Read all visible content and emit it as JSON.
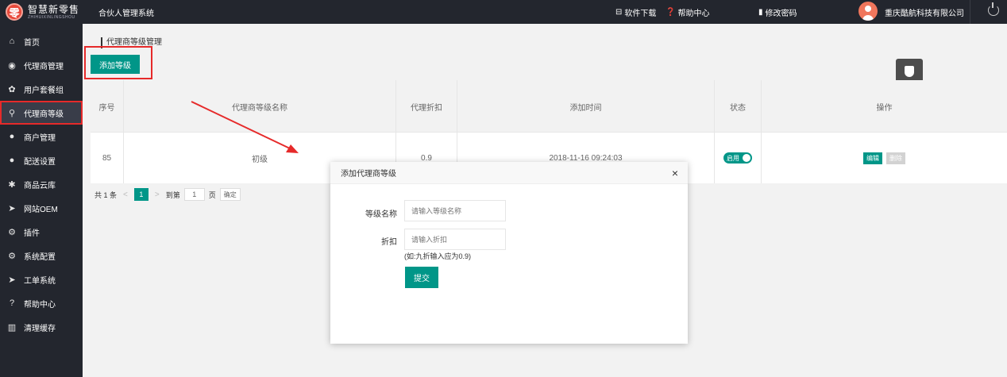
{
  "topbar": {
    "logo_cn": "智慧新零售",
    "logo_en": "ZHIHUIXINLINGSHOU",
    "logo_mark": "零",
    "system_title": "合伙人管理系统",
    "software_download": "软件下载",
    "help_center": "帮助中心",
    "change_password": "修改密码",
    "company": "重庆酷航科技有限公司"
  },
  "sidebar": {
    "items": [
      {
        "label": "首页",
        "icon": "home-icon",
        "glyph": "⌂"
      },
      {
        "label": "代理商管理",
        "icon": "agent-icon",
        "glyph": "◉"
      },
      {
        "label": "用户套餐组",
        "icon": "package-icon",
        "glyph": "✿"
      },
      {
        "label": "代理商等级",
        "icon": "level-icon",
        "glyph": "⚲"
      },
      {
        "label": "商户管理",
        "icon": "merchant-icon",
        "glyph": "●"
      },
      {
        "label": "配送设置",
        "icon": "delivery-icon",
        "glyph": "●"
      },
      {
        "label": "商品云库",
        "icon": "cloud-icon",
        "glyph": "✱"
      },
      {
        "label": "网站OEM",
        "icon": "website-icon",
        "glyph": "➤"
      },
      {
        "label": "插件",
        "icon": "plugin-icon",
        "glyph": "⚙"
      },
      {
        "label": "系统配置",
        "icon": "config-icon",
        "glyph": "⚙"
      },
      {
        "label": "工单系统",
        "icon": "ticket-icon",
        "glyph": "➤"
      },
      {
        "label": "帮助中心",
        "icon": "help-icon",
        "glyph": "?"
      },
      {
        "label": "清理缓存",
        "icon": "trash-icon",
        "glyph": "▥"
      }
    ],
    "active_index": 3
  },
  "main": {
    "breadcrumb": "代理商等级管理",
    "add_button": "添加等级",
    "table": {
      "headers": [
        "序号",
        "代理商等级名称",
        "代理折扣",
        "添加时间",
        "状态",
        "操作"
      ],
      "rows": [
        {
          "id": "85",
          "name": "初级",
          "discount": "0.9",
          "time": "2018-11-16 09:24:03",
          "status": "启用",
          "edit": "编辑",
          "delete": "删除"
        }
      ]
    },
    "pager": {
      "total": "共 1 条",
      "current": "1",
      "goto_label": "到第",
      "goto_value": "1",
      "page_label": "页",
      "confirm": "确定"
    }
  },
  "modal": {
    "title": "添加代理商等级",
    "close": "×",
    "level_name_label": "等级名称",
    "level_name_placeholder": "请输入等级名称",
    "discount_label": "折扣",
    "discount_placeholder": "请输入折扣",
    "hint": "(如:九折输入应为0.9)",
    "submit": "提交"
  },
  "colors": {
    "primary": "#009688",
    "sidebar_bg": "#23262e",
    "highlight": "#e62a2a"
  }
}
